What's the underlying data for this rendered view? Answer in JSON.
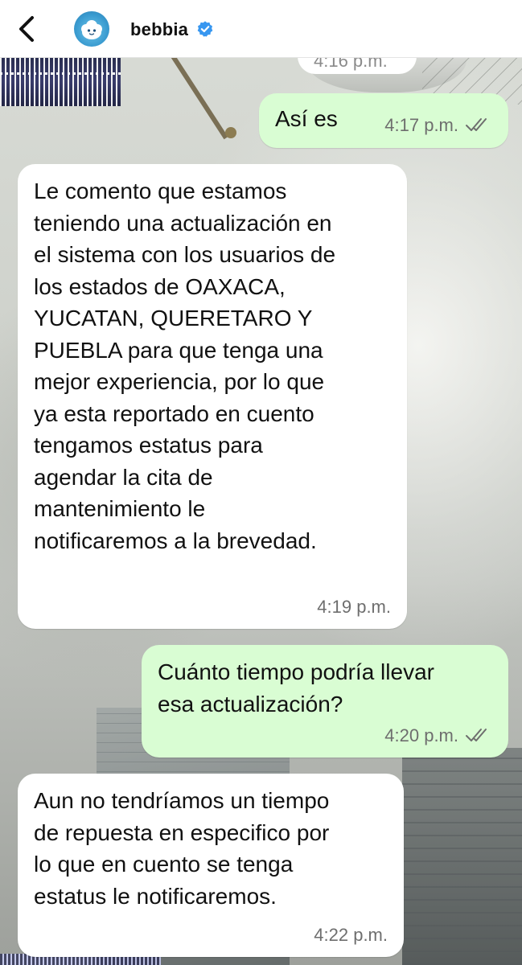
{
  "header": {
    "contact_name": "bebbia",
    "verified": true,
    "avatar_icon": "cloud-mascot-icon",
    "back_icon": "chevron-left-icon"
  },
  "messages": [
    {
      "direction": "incoming",
      "text": "",
      "time": "4:16 p.m.",
      "partial": true
    },
    {
      "direction": "outgoing",
      "text": "Así es",
      "time": "4:17 p.m.",
      "status": "read"
    },
    {
      "direction": "incoming",
      "text": "Le comento que estamos\nteniendo una actualización en\nel sistema con los usuarios de\nlos estados de OAXACA,\nYUCATAN, QUERETARO Y\nPUEBLA para que tenga una\nmejor experiencia, por lo que\nya esta reportado en cuento\ntengamos estatus para\nagendar la cita de\nmantenimiento le\nnotificaremos a la brevedad.",
      "time": "4:19 p.m."
    },
    {
      "direction": "outgoing",
      "text": "Cuánto tiempo podría llevar\nesa actualización?",
      "time": "4:20 p.m.",
      "status": "read"
    },
    {
      "direction": "incoming",
      "text": "Aun no tendríamos un tiempo\nde repuesta en especifico por\nlo que en cuento se tenga\nestatus le notificaremos.",
      "time": "4:22 p.m."
    }
  ],
  "colors": {
    "incoming_bubble": "#ffffff",
    "outgoing_bubble": "#d9fdd3",
    "verified_badge": "#3897f0",
    "timestamp": "#6e6e6e"
  }
}
